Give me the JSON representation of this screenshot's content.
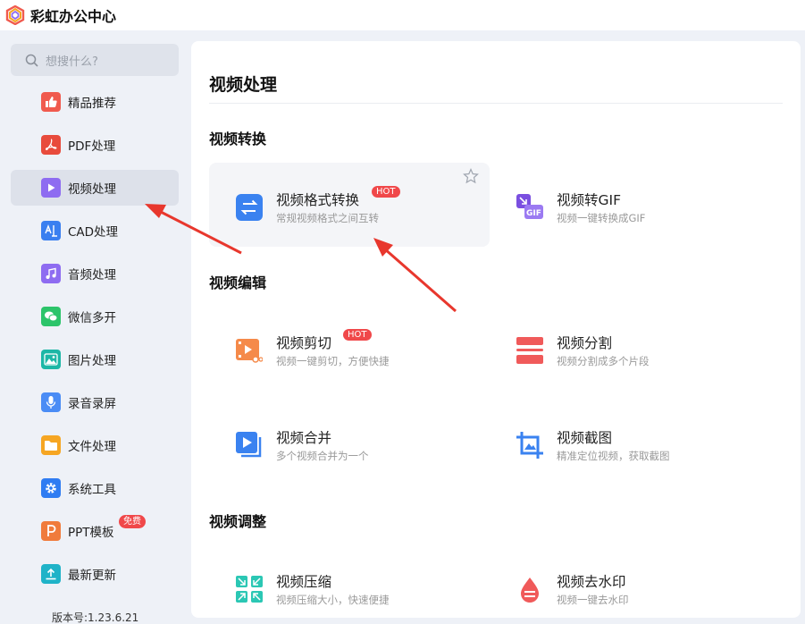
{
  "app": {
    "title": "彩虹办公中心"
  },
  "search": {
    "placeholder": "想搜什么?"
  },
  "sidebar": {
    "items": [
      {
        "label": "精品推荐",
        "icon": "thumbs-up-icon",
        "color": "#f05a4e"
      },
      {
        "label": "PDF处理",
        "icon": "pdf-icon",
        "color": "#e84b3c"
      },
      {
        "label": "视频处理",
        "icon": "play-icon",
        "color": "#8e6cf1",
        "active": true
      },
      {
        "label": "CAD处理",
        "icon": "cad-icon",
        "color": "#3a7ff0"
      },
      {
        "label": "音频处理",
        "icon": "music-note-icon",
        "color": "#8e6cf1"
      },
      {
        "label": "微信多开",
        "icon": "wechat-icon",
        "color": "#2cc46a"
      },
      {
        "label": "图片处理",
        "icon": "image-icon",
        "color": "#1db7a6"
      },
      {
        "label": "录音录屏",
        "icon": "microphone-icon",
        "color": "#4a8cf5"
      },
      {
        "label": "文件处理",
        "icon": "folder-icon",
        "color": "#f6a623"
      },
      {
        "label": "系统工具",
        "icon": "gear-icon",
        "color": "#2f7cf2"
      },
      {
        "label": "PPT模板",
        "icon": "ppt-icon",
        "color": "#f07b3c",
        "badge": "免费"
      },
      {
        "label": "最新更新",
        "icon": "upload-icon",
        "color": "#1fb3c8"
      }
    ]
  },
  "version": "版本号:1.23.6.21",
  "main": {
    "title": "视频处理",
    "sections": [
      {
        "title": "视频转换",
        "cards": [
          {
            "name": "视频格式转换",
            "desc": "常规视频格式之间互转",
            "hot": "HOT",
            "icon": "swap-arrows-icon"
          },
          {
            "name": "视频转GIF",
            "desc": "视频一键转换成GIF",
            "icon": "gif-icon"
          }
        ]
      },
      {
        "title": "视频编辑",
        "cards": [
          {
            "name": "视频剪切",
            "desc": "视频一键剪切，方便快捷",
            "hot": "HOT",
            "icon": "video-cut-icon"
          },
          {
            "name": "视频分割",
            "desc": "视频分割成多个片段",
            "icon": "split-icon"
          },
          {
            "name": "视频合并",
            "desc": "多个视频合并为一个",
            "icon": "video-merge-icon"
          },
          {
            "name": "视频截图",
            "desc": "精准定位视频，获取截图",
            "icon": "crop-icon"
          }
        ]
      },
      {
        "title": "视频调整",
        "cards": [
          {
            "name": "视频压缩",
            "desc": "视频压缩大小，快速便捷",
            "icon": "compress-icon"
          },
          {
            "name": "视频去水印",
            "desc": "视频一键去水印",
            "icon": "watermark-remove-icon"
          }
        ]
      }
    ]
  },
  "colors": {
    "accent": "#3a82f0",
    "hot": "#f0484a",
    "annotation": "#e8372d"
  }
}
